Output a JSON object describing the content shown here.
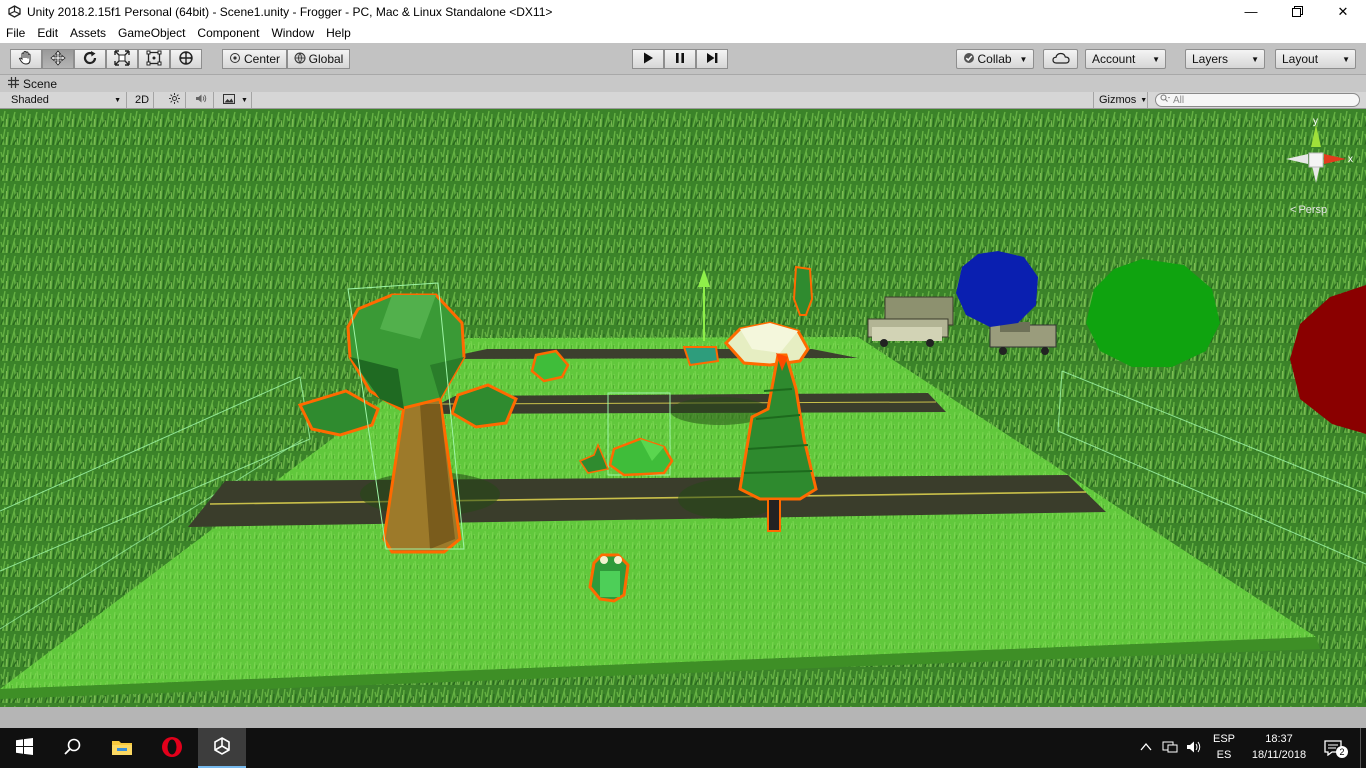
{
  "window": {
    "title": "Unity 2018.2.15f1 Personal (64bit) - Scene1.unity - Frogger - PC, Mac & Linux Standalone <DX11>"
  },
  "menu": [
    "File",
    "Edit",
    "Assets",
    "GameObject",
    "Component",
    "Window",
    "Help"
  ],
  "toolbar": {
    "tools": [
      "hand-icon",
      "move-icon",
      "rotate-icon",
      "scale-icon",
      "rect-icon",
      "transform-icon"
    ],
    "pivot_label": "Center",
    "space_label": "Global",
    "collab_label": "Collab",
    "account_label": "Account",
    "layers_label": "Layers",
    "layout_label": "Layout"
  },
  "scene_tab": {
    "label": "Scene"
  },
  "scene_bar": {
    "draw_mode": "Shaded",
    "mode_2d": "2D",
    "gizmos_label": "Gizmos",
    "search_placeholder": "All"
  },
  "gizmo": {
    "y_label": "y",
    "x_label": "x",
    "projection_label": "Persp"
  },
  "taskbar": {
    "lang_top": "ESP",
    "lang_bottom": "ES",
    "time": "18:37",
    "date": "18/11/2018",
    "notification_count": "2"
  },
  "colors": {
    "selection_outline": "#ff6a00",
    "grass": "#5cc23a",
    "unity_bg": "#c2c2c2"
  }
}
